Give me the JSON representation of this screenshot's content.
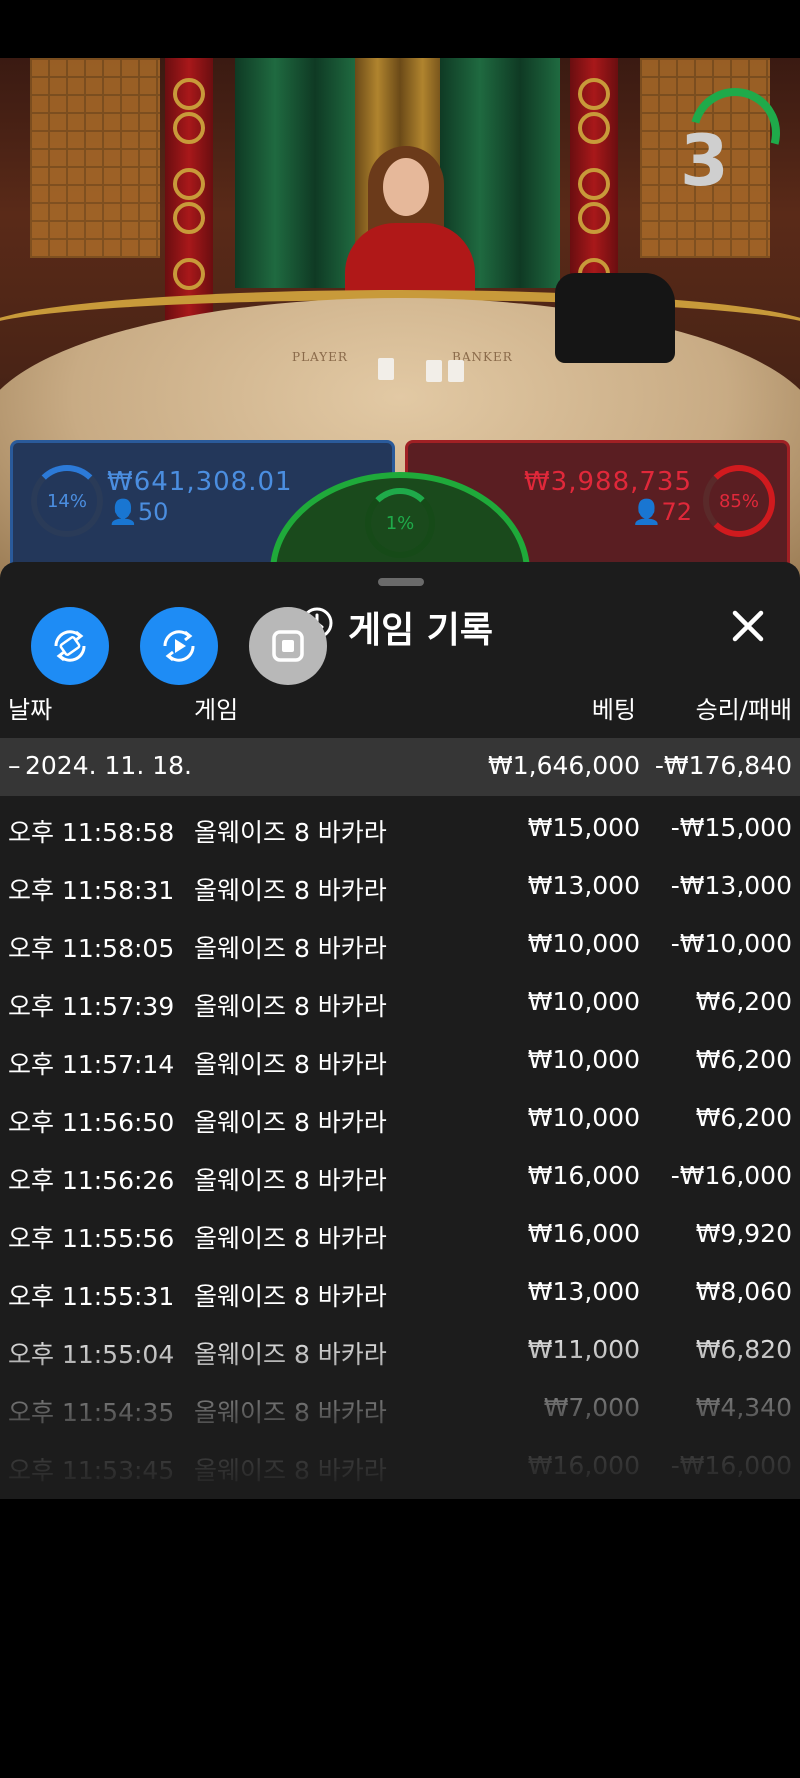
{
  "video": {
    "countdown": "3",
    "table_player_text": "PLAYER",
    "table_banker_text": "BANKER",
    "player": {
      "percent": "14%",
      "amount": "₩641,308.01",
      "count": "50"
    },
    "banker": {
      "percent": "85%",
      "amount": "₩3,988,735",
      "count": "72"
    },
    "tie": {
      "percent": "1%"
    }
  },
  "buttons": {
    "first": "swap-icon",
    "second": "replay-icon",
    "third": "stop-icon"
  },
  "sheet": {
    "title": "게임 기록",
    "headers": {
      "date": "날짜",
      "game": "게임",
      "bet": "베팅",
      "result": "승리/패배"
    },
    "date_group": {
      "toggle": "–",
      "date": "2024. 11. 18.",
      "bet_total": "₩1,646,000",
      "result_total": "-₩176,840"
    },
    "rows": [
      {
        "time": "오후 11:58:58",
        "game": "올웨이즈 8 바카라",
        "bet": "₩15,000",
        "result": "-₩15,000"
      },
      {
        "time": "오후 11:58:31",
        "game": "올웨이즈 8 바카라",
        "bet": "₩13,000",
        "result": "-₩13,000"
      },
      {
        "time": "오후 11:58:05",
        "game": "올웨이즈 8 바카라",
        "bet": "₩10,000",
        "result": "-₩10,000"
      },
      {
        "time": "오후 11:57:39",
        "game": "올웨이즈 8 바카라",
        "bet": "₩10,000",
        "result": "₩6,200"
      },
      {
        "time": "오후 11:57:14",
        "game": "올웨이즈 8 바카라",
        "bet": "₩10,000",
        "result": "₩6,200"
      },
      {
        "time": "오후 11:56:50",
        "game": "올웨이즈 8 바카라",
        "bet": "₩10,000",
        "result": "₩6,200"
      },
      {
        "time": "오후 11:56:26",
        "game": "올웨이즈 8 바카라",
        "bet": "₩16,000",
        "result": "-₩16,000"
      },
      {
        "time": "오후 11:55:56",
        "game": "올웨이즈 8 바카라",
        "bet": "₩16,000",
        "result": "₩9,920"
      },
      {
        "time": "오후 11:55:31",
        "game": "올웨이즈 8 바카라",
        "bet": "₩13,000",
        "result": "₩8,060"
      },
      {
        "time": "오후 11:55:04",
        "game": "올웨이즈 8 바카라",
        "bet": "₩11,000",
        "result": "₩6,820"
      },
      {
        "time": "오후 11:54:35",
        "game": "올웨이즈 8 바카라",
        "bet": "₩7,000",
        "result": "₩4,340"
      },
      {
        "time": "오후 11:53:45",
        "game": "올웨이즈 8 바카라",
        "bet": "₩16,000",
        "result": "-₩16,000"
      }
    ]
  },
  "colors": {
    "accent_blue": "#1e8cf5",
    "player_blue": "#4b8ee0",
    "banker_red": "#e0283a",
    "tie_green": "#1faa4a"
  }
}
